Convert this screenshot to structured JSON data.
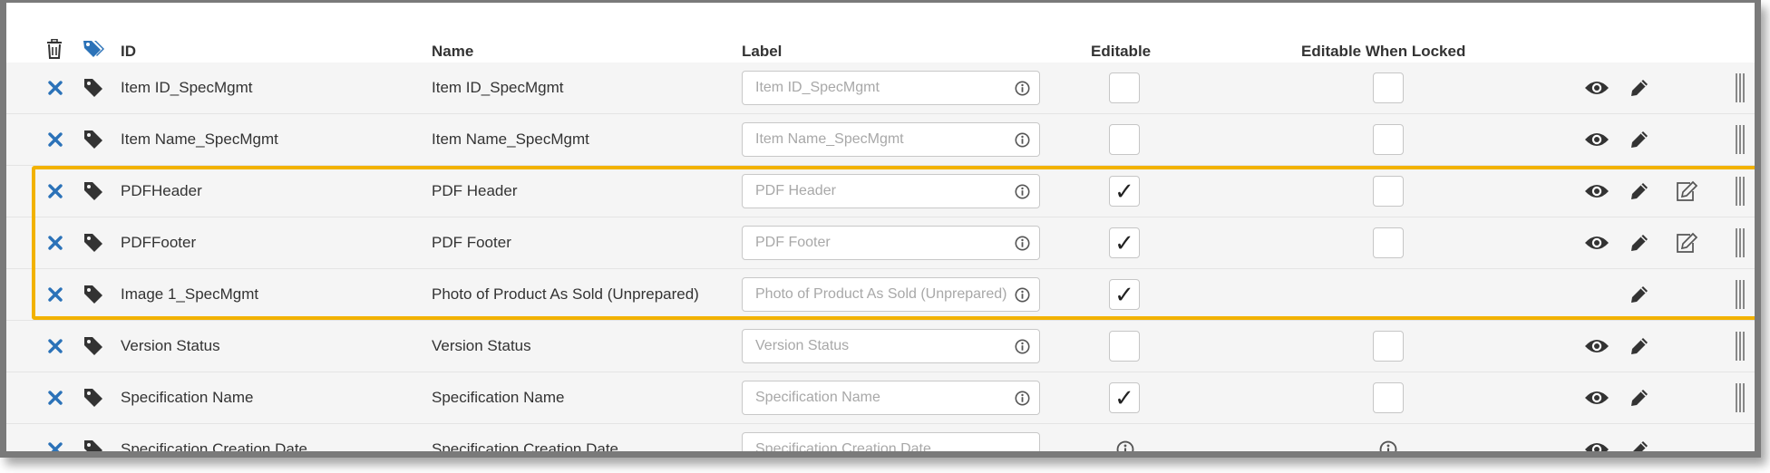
{
  "header": {
    "id": "ID",
    "name": "Name",
    "label": "Label",
    "editable": "Editable",
    "editable_when_locked": "Editable When Locked"
  },
  "rows": [
    {
      "id": "Item ID_SpecMgmt",
      "name": "Item ID_SpecMgmt",
      "label_placeholder": "Item ID_SpecMgmt",
      "editable": "",
      "locked": ""
    },
    {
      "id": "Item Name_SpecMgmt",
      "name": "Item Name_SpecMgmt",
      "label_placeholder": "Item Name_SpecMgmt",
      "editable": "",
      "locked": ""
    },
    {
      "id": "PDFHeader",
      "name": "PDF Header",
      "label_placeholder": "PDF Header",
      "editable": "✓",
      "locked": ""
    },
    {
      "id": "PDFFooter",
      "name": "PDF Footer",
      "label_placeholder": "PDF Footer",
      "editable": "✓",
      "locked": ""
    },
    {
      "id": "Image 1_SpecMgmt",
      "name": "Photo of Product As Sold (Unprepared)",
      "label_placeholder": "Photo of Product As Sold (Unprepared)",
      "editable": "✓",
      "locked": ""
    },
    {
      "id": "Version Status",
      "name": "Version Status",
      "label_placeholder": "Version Status",
      "editable": "",
      "locked": ""
    },
    {
      "id": "Specification Name",
      "name": "Specification Name",
      "label_placeholder": "Specification Name",
      "editable": "✓",
      "locked": ""
    },
    {
      "id": "Specification Creation Date",
      "name": "Specification Creation Date",
      "label_placeholder": "Specification Creation Date",
      "editable": "",
      "locked": ""
    }
  ],
  "icons": {
    "delete_all": "trash-icon",
    "tag_header": "tag-icon",
    "remove": "close-icon",
    "tag": "tag-icon",
    "info": "info-icon",
    "view": "eye-icon",
    "edit": "pencil-icon",
    "edit_note": "edit-note-icon",
    "drag": "drag-handle-icon"
  },
  "colors": {
    "accent_blue": "#2b72b8",
    "highlight": "#f2b200",
    "icon_dark": "#333333"
  }
}
